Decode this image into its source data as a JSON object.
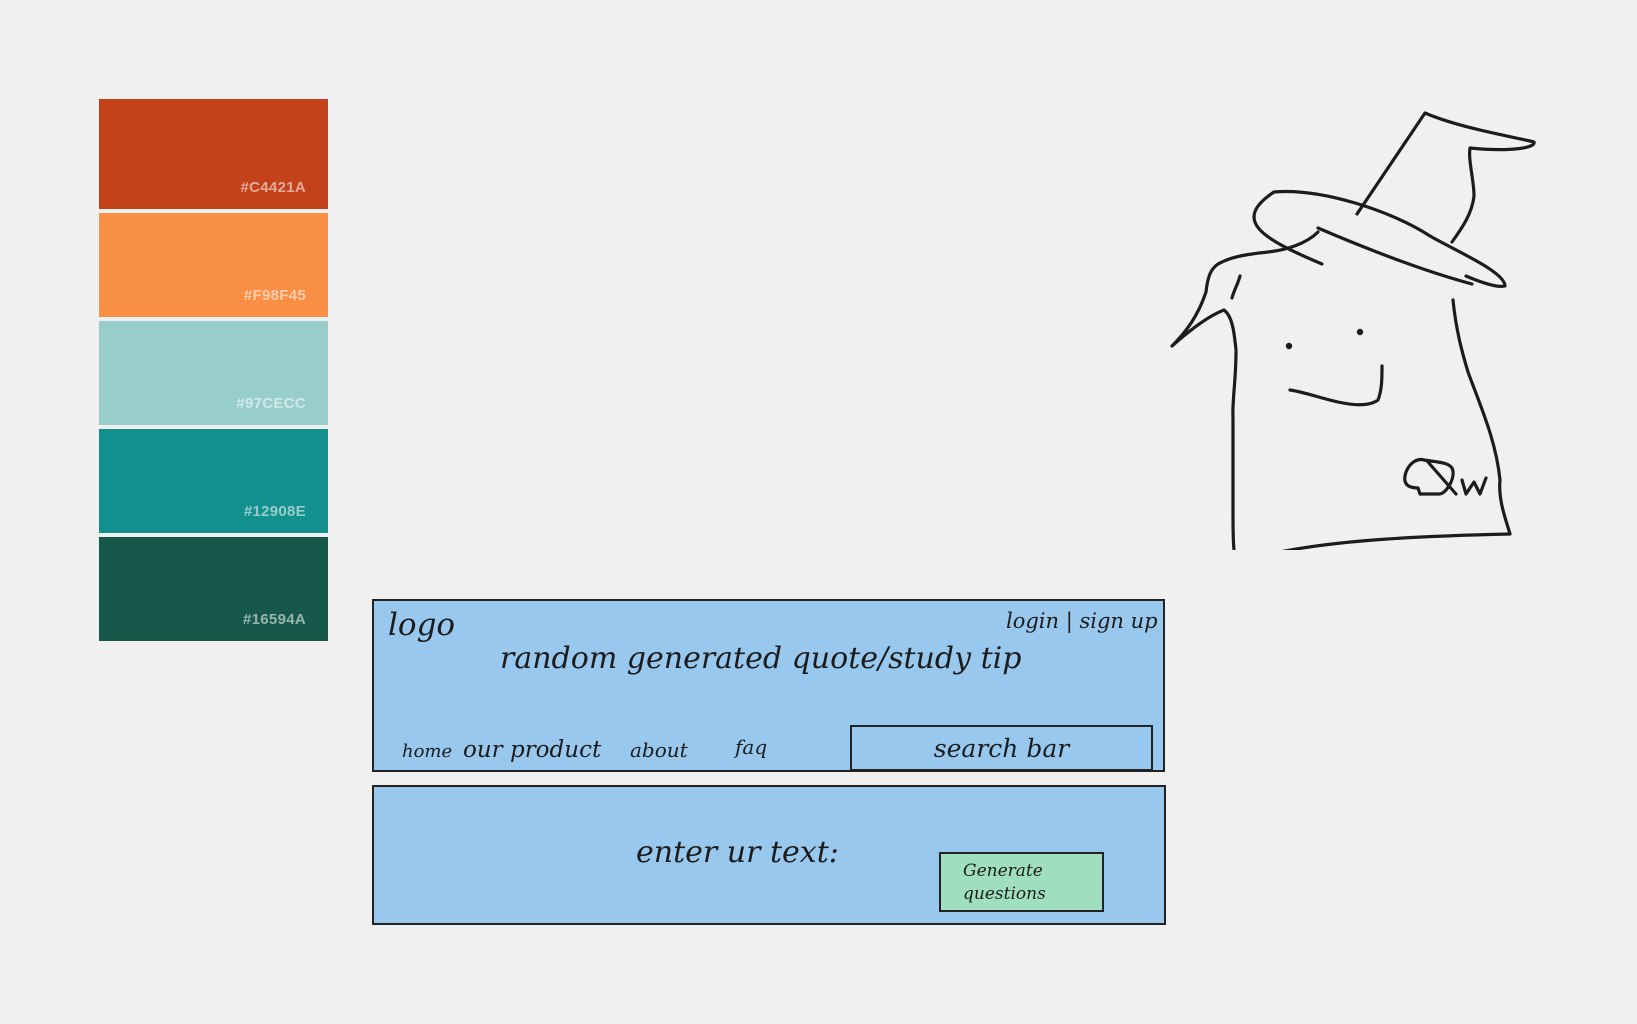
{
  "palette": [
    {
      "hex": "#C4421A",
      "label": "#C4421A",
      "height": 110
    },
    {
      "hex": "#F98F45",
      "label": "#F98F45",
      "height": 104
    },
    {
      "hex": "#97CECC",
      "label": "#97CECC",
      "height": 104
    },
    {
      "hex": "#12908E",
      "label": "#12908E",
      "height": 104
    },
    {
      "hex": "#16594A",
      "label": "#16594A",
      "height": 104
    }
  ],
  "header": {
    "logo": "logo",
    "auth": "login | sign up",
    "tagline": "random generated quote/study tip",
    "nav": {
      "home": "home",
      "product": "our product",
      "about": "about",
      "faq": "faq"
    },
    "search": "search bar"
  },
  "input_section": {
    "prompt": "enter ur text:",
    "button_line1": "Generate",
    "button_line2": "questions"
  },
  "colors": {
    "frame_fill": "#99c8ef",
    "button_fill": "#9fdfc0",
    "background": "#f0f0f0"
  },
  "mascot": {
    "icon": "wizard-mascot-icon",
    "badge": "QW"
  }
}
